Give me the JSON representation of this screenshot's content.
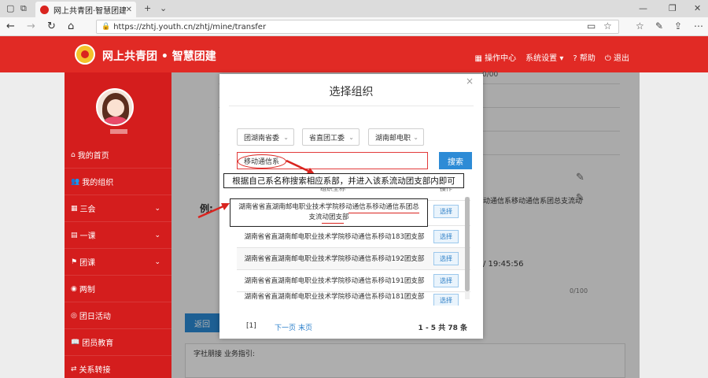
{
  "browser": {
    "tab_title": "网上共青团·智慧团建",
    "url": "https://zhtj.youth.cn/zhtj/mine/transfer"
  },
  "header": {
    "site_name": "网上共青团 • 智慧团建",
    "menu": [
      "操作中心",
      "系统设置",
      "帮助",
      "退出"
    ]
  },
  "sidebar": {
    "items": [
      {
        "label": "我的首页",
        "expandable": false
      },
      {
        "label": "我的组织",
        "expandable": false
      },
      {
        "label": "三会",
        "expandable": true
      },
      {
        "label": "一课",
        "expandable": true
      },
      {
        "label": "团课",
        "expandable": true
      },
      {
        "label": "两制",
        "expandable": false
      },
      {
        "label": "团日活动",
        "expandable": false
      },
      {
        "label": "团员教育",
        "expandable": false
      },
      {
        "label": "关系转接",
        "expandable": false
      }
    ]
  },
  "main": {
    "top_text": "0/00",
    "bg_row_text": "动通信系移动通信系团总支流动",
    "example_label": "例:",
    "timestamp": "/ 19:45:56",
    "counter": "0/100",
    "back_label": "返回",
    "notes_label": "字社朋接 业务指引:"
  },
  "modal": {
    "title": "选择组织",
    "filters": [
      "团湖南省委",
      "省直团工委",
      "湖南邮电职"
    ],
    "search_value": "移动通信系",
    "search_button": "搜索",
    "columns": [
      "组织全称",
      "操作"
    ],
    "rows": [
      {
        "name": "湖南省省直湖南邮电职业技术学院移动通信系移动通信系团总支流动团支部",
        "action": "选择"
      },
      {
        "name": "湖南省省直湖南邮电职业技术学院移动通信系移动183团支部",
        "action": "选择"
      },
      {
        "name": "湖南省省直湖南邮电职业技术学院移动通信系移动192团支部",
        "action": "选择"
      },
      {
        "name": "湖南省省直湖南邮电职业技术学院移动通信系移动191团支部",
        "action": "选择"
      },
      {
        "name": "湖南省省直湖南邮电职业技术学院移动通信系移动181团支部",
        "action": "选择"
      }
    ],
    "pager": {
      "current": "[1]",
      "next": "下一页",
      "last": "末页",
      "total": "1 - 5  共 78 条"
    }
  },
  "annotations": {
    "instruction": "根据自己系名称搜索相应系部，并进入该系流动团支部内即可",
    "accent": "#d9241f"
  }
}
